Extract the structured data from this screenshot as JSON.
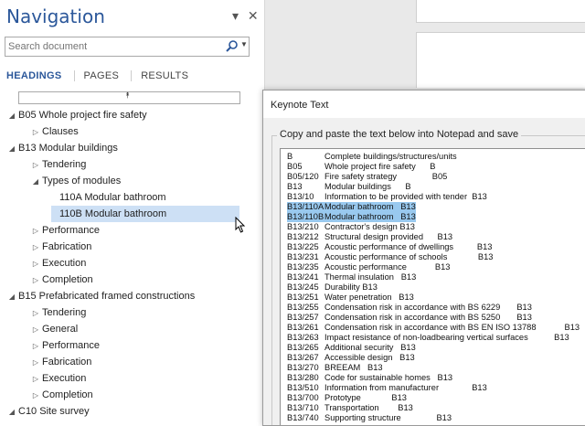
{
  "nav": {
    "title": "Navigation",
    "ctrl_dropdown": "▾",
    "ctrl_close": "✕",
    "search": {
      "placeholder": "Search document",
      "value": ""
    },
    "tabs": [
      "HEADINGS",
      "PAGES",
      "RESULTS"
    ],
    "active_tab": "HEADINGS",
    "collapse_glyph": "⯭",
    "tree": [
      {
        "label": "B05 Whole project fire safety",
        "level": 0,
        "state": "expanded"
      },
      {
        "label": "Clauses",
        "level": 1,
        "state": "collapsed"
      },
      {
        "label": "B13 Modular buildings",
        "level": 0,
        "state": "expanded"
      },
      {
        "label": "Tendering",
        "level": 1,
        "state": "collapsed"
      },
      {
        "label": "Types of modules",
        "level": 1,
        "state": "expanded"
      },
      {
        "label": "110A Modular bathroom",
        "level": 2,
        "state": "leaf"
      },
      {
        "label": "110B Modular bathroom",
        "level": 2,
        "state": "leaf",
        "selected": true
      },
      {
        "label": "Performance",
        "level": 1,
        "state": "collapsed"
      },
      {
        "label": "Fabrication",
        "level": 1,
        "state": "collapsed"
      },
      {
        "label": "Execution",
        "level": 1,
        "state": "collapsed"
      },
      {
        "label": "Completion",
        "level": 1,
        "state": "collapsed"
      },
      {
        "label": "B15 Prefabricated framed constructions",
        "level": 0,
        "state": "expanded"
      },
      {
        "label": "Tendering",
        "level": 1,
        "state": "collapsed"
      },
      {
        "label": "General",
        "level": 1,
        "state": "collapsed"
      },
      {
        "label": "Performance",
        "level": 1,
        "state": "collapsed"
      },
      {
        "label": "Fabrication",
        "level": 1,
        "state": "collapsed"
      },
      {
        "label": "Execution",
        "level": 1,
        "state": "collapsed"
      },
      {
        "label": "Completion",
        "level": 1,
        "state": "collapsed"
      },
      {
        "label": "C10 Site survey",
        "level": 0,
        "state": "expanded"
      }
    ]
  },
  "dialog": {
    "title": "Keynote Text",
    "group_label": "Copy and paste the text below into Notepad and save",
    "lines": [
      {
        "code": "B",
        "text": "Complete buildings/structures/units"
      },
      {
        "code": "B05",
        "text": "Whole project fire safety      B"
      },
      {
        "code": "B05/120",
        "text": "Fire safety strategy               B05"
      },
      {
        "code": "B13",
        "text": "Modular buildings      B"
      },
      {
        "code": "B13/10",
        "text": "Information to be provided with tender  B13"
      },
      {
        "code": "B13/110A",
        "text": "Modular bathroom   B13",
        "highlight": true
      },
      {
        "code": "B13/110B",
        "text": "Modular bathroom   B13",
        "highlight": true
      },
      {
        "code": "B13/210",
        "text": "Contractor's design B13"
      },
      {
        "code": "B13/212",
        "text": "Structural design provided      B13"
      },
      {
        "code": "B13/225",
        "text": "Acoustic performance of dwellings          B13"
      },
      {
        "code": "B13/231",
        "text": "Acoustic performance of schools             B13"
      },
      {
        "code": "B13/235",
        "text": "Acoustic performance            B13"
      },
      {
        "code": "B13/241",
        "text": "Thermal insulation   B13"
      },
      {
        "code": "B13/245",
        "text": "Durability B13"
      },
      {
        "code": "B13/251",
        "text": "Water penetration   B13"
      },
      {
        "code": "B13/255",
        "text": "Condensation risk in accordance with BS 6229       B13"
      },
      {
        "code": "B13/257",
        "text": "Condensation risk in accordance with BS 5250       B13"
      },
      {
        "code": "B13/261",
        "text": "Condensation risk in accordance with BS EN ISO 13788            B13"
      },
      {
        "code": "B13/263",
        "text": "Impact resistance of non-loadbearing vertical surfaces           B13"
      },
      {
        "code": "B13/265",
        "text": "Additional security   B13"
      },
      {
        "code": "B13/267",
        "text": "Accessible design   B13"
      },
      {
        "code": "B13/270",
        "text": "BREEAM   B13"
      },
      {
        "code": "B13/280",
        "text": "Code for sustainable homes   B13"
      },
      {
        "code": "B13/510",
        "text": "Information from manufacturer              B13"
      },
      {
        "code": "B13/700",
        "text": "Prototype             B13"
      },
      {
        "code": "B13/710",
        "text": "Transportation        B13"
      },
      {
        "code": "B13/740",
        "text": "Supporting structure               B13"
      }
    ]
  }
}
